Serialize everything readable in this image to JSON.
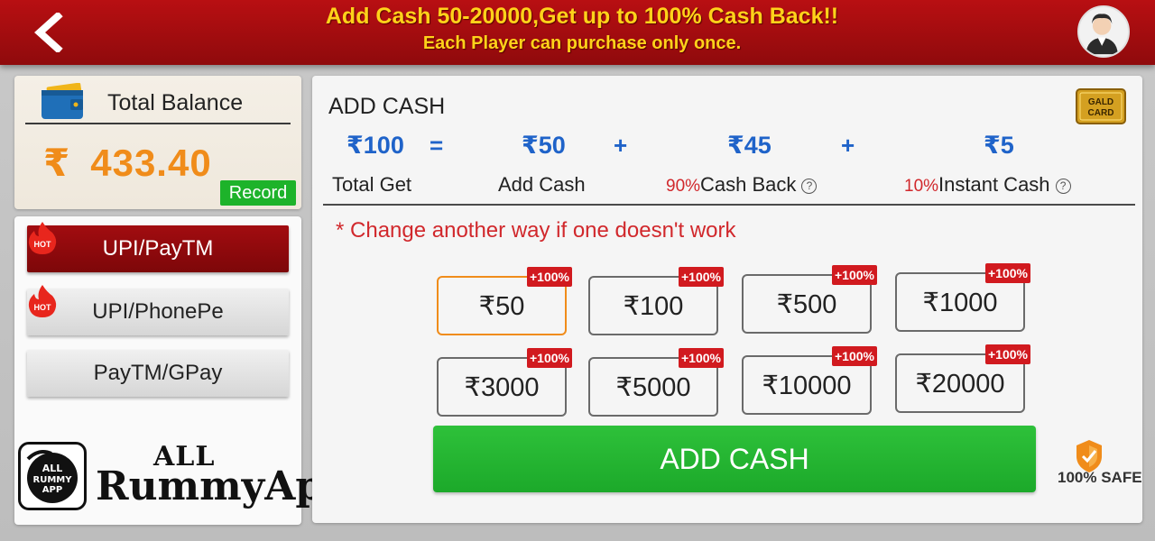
{
  "header": {
    "banner_line1": "Add Cash 50-20000,Get up to 100% Cash Back!!",
    "banner_line2": "Each Player can purchase only once.",
    "back_icon": "chevron-left-icon",
    "avatar_icon": "user-avatar-icon"
  },
  "balance": {
    "label": "Total Balance",
    "currency": "₹",
    "amount": "433.40",
    "record_label": "Record"
  },
  "methods": [
    {
      "label": "UPI/PayTM",
      "hot": true,
      "active": true
    },
    {
      "label": "UPI/PhonePe",
      "hot": true,
      "active": false
    },
    {
      "label": "PayTM/GPay",
      "hot": false,
      "active": false
    }
  ],
  "hot_badge": "HOT",
  "watermark": {
    "all": "ALL",
    "main": "RummyApp.In",
    "logo_lines": [
      "ALL",
      "RUMMY",
      "APP"
    ]
  },
  "add_cash": {
    "title": "ADD CASH",
    "gold_card": "GALD CARD",
    "breakdown": {
      "total": "₹100",
      "add": "₹50",
      "cashback": "₹45",
      "instant": "₹5",
      "eq": "=",
      "plus": "+",
      "total_label": "Total Get",
      "add_label": "Add Cash",
      "cashback_pct": "90%",
      "cashback_label": "Cash Back",
      "instant_pct": "10%",
      "instant_label": "Instant Cash",
      "help": "?"
    },
    "warning": "* Change another way if one doesn't work",
    "amounts": [
      "₹50",
      "₹100",
      "₹500",
      "₹1000",
      "₹3000",
      "₹5000",
      "₹10000",
      "₹20000"
    ],
    "selected_index": 0,
    "bonus": "+100%",
    "button": "ADD CASH",
    "safe_label": "100% SAFE"
  },
  "colors": {
    "header": "#a50d10",
    "accent_gold": "#ffd21a",
    "balance": "#f08c1a",
    "blue": "#1f63c9",
    "red": "#d1282c",
    "green": "#1db32a"
  }
}
